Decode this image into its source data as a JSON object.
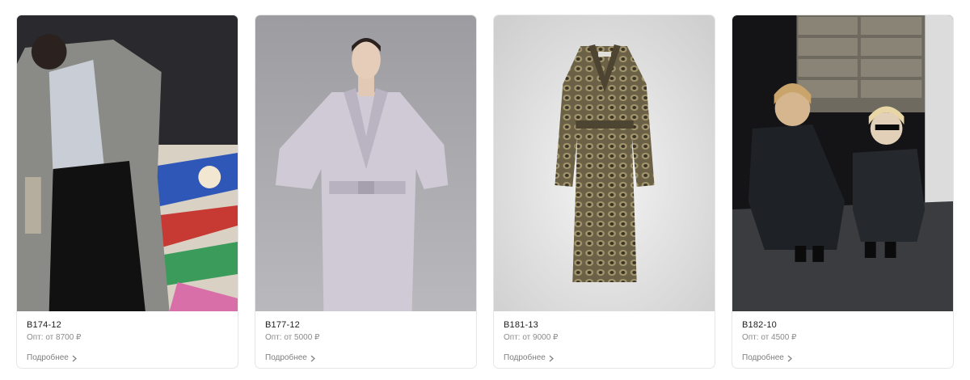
{
  "products": [
    {
      "sku": "B174-12",
      "price": "Опт: от 8700 ₽",
      "more": "Подробнее",
      "image": "model-gray-distressed-coat-graffiti"
    },
    {
      "sku": "B177-12",
      "price": "Опт: от 5000 ₽",
      "more": "Подробнее",
      "image": "model-lavender-trench-coat"
    },
    {
      "sku": "B181-13",
      "price": "Опт: от 9000 ₽",
      "more": "Подробнее",
      "image": "snakeskin-print-coat"
    },
    {
      "sku": "B182-10",
      "price": "Опт: от 4500 ₽",
      "more": "Подробнее",
      "image": "two-models-black-coats"
    }
  ],
  "colors": {
    "border": "#e6e6e6",
    "text": "#1d1d1d",
    "muted": "#8a8a8a"
  },
  "icons": {
    "more": "chevron-right-icon"
  }
}
